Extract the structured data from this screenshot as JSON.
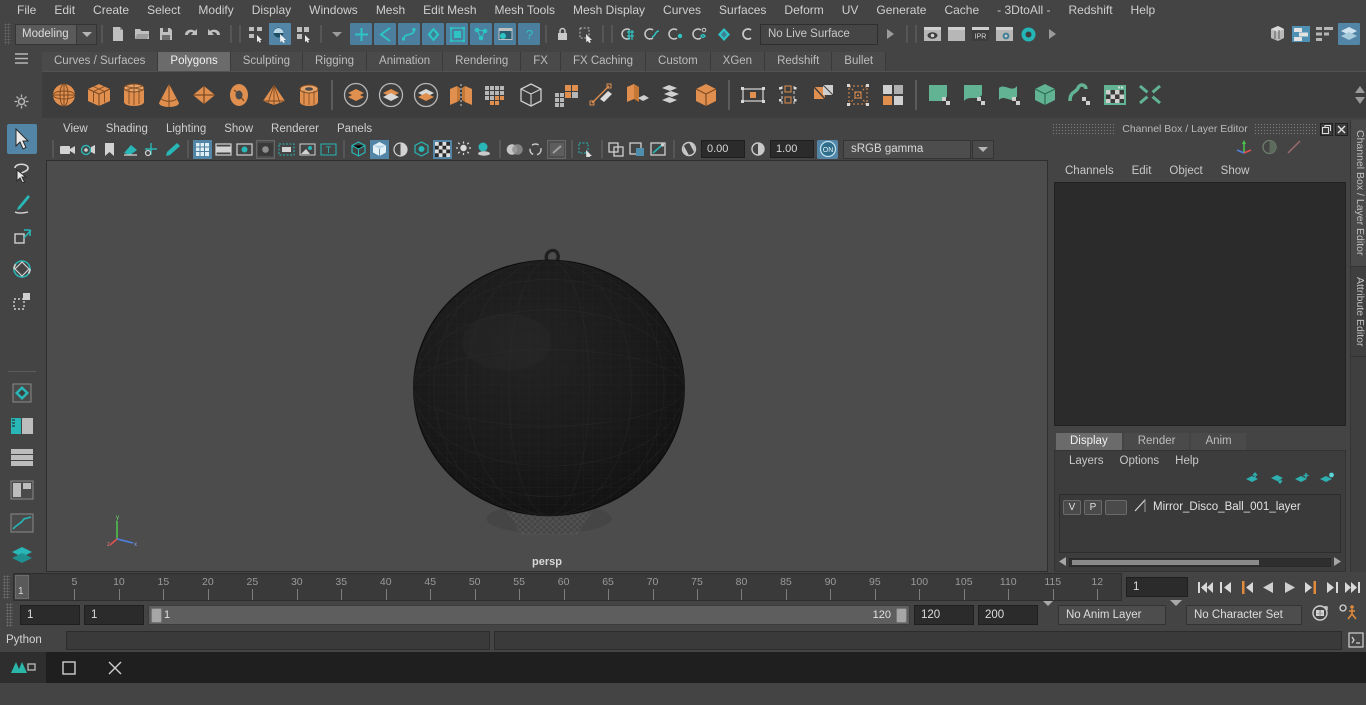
{
  "menubar": {
    "items": [
      "File",
      "Edit",
      "Create",
      "Select",
      "Modify",
      "Display",
      "Windows",
      "Mesh",
      "Edit Mesh",
      "Mesh Tools",
      "Mesh Display",
      "Curves",
      "Surfaces",
      "Deform",
      "UV",
      "Generate",
      "Cache",
      "- 3DtoAll -",
      "Redshift",
      "Help"
    ]
  },
  "statusline": {
    "menu_set": "Modeling",
    "live_surface": "No Live Surface",
    "icons": [
      {
        "name": "new-scene-icon"
      },
      {
        "name": "open-scene-icon"
      },
      {
        "name": "save-scene-icon"
      },
      {
        "name": "undo-icon"
      },
      {
        "name": "redo-icon"
      },
      {
        "name": "select-hierarchy-icon"
      },
      {
        "name": "select-object-icon"
      },
      {
        "name": "select-component-icon"
      },
      {
        "name": "snap-grid-icon"
      },
      {
        "name": "snap-curve-icon"
      },
      {
        "name": "snap-point-icon"
      },
      {
        "name": "snap-projected-center-icon"
      },
      {
        "name": "snap-view-plane-icon"
      },
      {
        "name": "make-live-icon"
      },
      {
        "name": "render-current-frame-icon"
      },
      {
        "name": "render-sequence-icon"
      },
      {
        "name": "ipr-render-icon"
      },
      {
        "name": "render-settings-icon"
      },
      {
        "name": "hypershade-icon"
      },
      {
        "name": "outliner-icon"
      },
      {
        "name": "node-editor-icon"
      },
      {
        "name": "attribute-editor-icon"
      },
      {
        "name": "channel-box-icon"
      }
    ]
  },
  "shelf": {
    "tabs": [
      "Curves / Surfaces",
      "Polygons",
      "Sculpting",
      "Rigging",
      "Animation",
      "Rendering",
      "FX",
      "FX Caching",
      "Custom",
      "XGen",
      "Redshift",
      "Bullet"
    ],
    "active_tab": "Polygons",
    "items": [
      {
        "name": "poly-sphere-icon",
        "color": "#e08f4e"
      },
      {
        "name": "poly-cube-icon",
        "color": "#e08f4e"
      },
      {
        "name": "poly-cylinder-icon",
        "color": "#e08f4e"
      },
      {
        "name": "poly-cone-icon",
        "color": "#e08f4e"
      },
      {
        "name": "poly-plane-icon",
        "color": "#e08f4e"
      },
      {
        "name": "poly-torus-icon",
        "color": "#e08f4e"
      },
      {
        "name": "poly-pyramid-icon",
        "color": "#e08f4e"
      },
      {
        "name": "poly-pipe-icon",
        "color": "#e08f4e"
      },
      {
        "name": "boolean-union-icon",
        "color": "#e08f4e"
      },
      {
        "name": "boolean-difference-icon",
        "color": "#e08f4e"
      },
      {
        "name": "boolean-intersection-icon",
        "color": "#e08f4e"
      },
      {
        "name": "mirror-geometry-icon",
        "color": "#e08f4e"
      },
      {
        "name": "smooth-mesh-icon",
        "color": "#b0b0b0"
      },
      {
        "name": "reduce-mesh-icon",
        "color": "#b0b0b0"
      },
      {
        "name": "quad-draw-icon",
        "color": "#e08f4e"
      },
      {
        "name": "multi-cut-icon",
        "color": "#e08f4e"
      },
      {
        "name": "extrude-icon",
        "color": "#e08f4e"
      },
      {
        "name": "bevel-icon",
        "color": "#b0b0b0"
      },
      {
        "name": "combine-icon",
        "color": "#e08f4e"
      },
      {
        "name": "uv-editor-icon",
        "color": "#d0d0d0"
      },
      {
        "name": "uv-planar-icon",
        "color": "#d0d0d0"
      },
      {
        "name": "uv-cut-icon",
        "color": "#e08f4e"
      },
      {
        "name": "uv-unfold-icon",
        "color": "#d0d0d0"
      },
      {
        "name": "uv-layout-icon",
        "color": "#d0d0d0"
      },
      {
        "name": "sculpt-plane-icon",
        "color": "#62b394"
      },
      {
        "name": "sculpt-curve-icon",
        "color": "#62b394"
      },
      {
        "name": "sculpt-surface-icon",
        "color": "#62b394"
      },
      {
        "name": "sculpt-cube-icon",
        "color": "#62b394"
      },
      {
        "name": "sculpt-wave-icon",
        "color": "#62b394"
      },
      {
        "name": "texture-window-icon",
        "color": "#62b394"
      },
      {
        "name": "transfer-attributes-icon",
        "color": "#62b394"
      }
    ]
  },
  "toolbox": {
    "items": [
      {
        "name": "select-tool"
      },
      {
        "name": "lasso-select-tool"
      },
      {
        "name": "paint-select-tool"
      },
      {
        "name": "move-tool"
      },
      {
        "name": "rotate-tool"
      },
      {
        "name": "scale-tool"
      },
      {
        "name": "last-tool-used"
      },
      {
        "name": "quick-layout-single"
      },
      {
        "name": "quick-layout-four"
      },
      {
        "name": "quick-layout-persp-outliner"
      },
      {
        "name": "quick-layout-persp-graph"
      },
      {
        "name": "quick-layout-hypershade"
      },
      {
        "name": "quick-layout-persp-uv"
      }
    ]
  },
  "viewport": {
    "menus": [
      "View",
      "Shading",
      "Lighting",
      "Show",
      "Renderer",
      "Panels"
    ],
    "camera_label": "persp",
    "exposure": "0.00",
    "gamma": "1.00",
    "color_management": "sRGB gamma",
    "toolbar_icons": [
      {
        "name": "select-camera-icon"
      },
      {
        "name": "camera-attributes-icon"
      },
      {
        "name": "bookmark-icon"
      },
      {
        "name": "image-plane-icon"
      },
      {
        "name": "two-d-pan-zoom-icon"
      },
      {
        "name": "grease-pencil-icon"
      },
      {
        "name": "grid-toggle-icon"
      },
      {
        "name": "film-gate-icon"
      },
      {
        "name": "resolution-gate-icon"
      },
      {
        "name": "gate-mask-icon"
      },
      {
        "name": "field-chart-icon"
      },
      {
        "name": "safe-action-icon"
      },
      {
        "name": "safe-title-icon"
      },
      {
        "name": "wireframe-shading-icon"
      },
      {
        "name": "smooth-shade-all-icon"
      },
      {
        "name": "shaded-wireframe-icon"
      },
      {
        "name": "use-default-material-icon"
      },
      {
        "name": "xray-display-icon"
      },
      {
        "name": "textured-mode-icon"
      },
      {
        "name": "use-all-lights-icon"
      },
      {
        "name": "shadows-icon"
      },
      {
        "name": "screen-space-ao-icon"
      },
      {
        "name": "motion-blur-icon"
      },
      {
        "name": "multisample-aa-icon"
      },
      {
        "name": "isolate-select-icon"
      },
      {
        "name": "xray-joints-icon"
      },
      {
        "name": "xray-active-components-icon"
      },
      {
        "name": "exposure-icon"
      },
      {
        "name": "gamma-icon"
      },
      {
        "name": "color-management-toggle-icon"
      }
    ]
  },
  "right_panel": {
    "title": "Channel Box / Layer Editor",
    "menus": [
      "Channels",
      "Edit",
      "Object",
      "Show"
    ],
    "vertical_tabs": [
      "Channel Box / Layer Editor",
      "Attribute Editor"
    ],
    "layer_tabs": [
      "Display",
      "Render",
      "Anim"
    ],
    "active_layer_tab": "Display",
    "layer_menus": [
      "Layers",
      "Options",
      "Help"
    ],
    "layers": [
      {
        "visibility": "V",
        "playback": "P",
        "color_swatch": "",
        "name": "Mirror_Disco_Ball_001_layer"
      }
    ]
  },
  "timeline": {
    "ticks": [
      5,
      10,
      15,
      20,
      25,
      30,
      35,
      40,
      45,
      50,
      55,
      60,
      65,
      70,
      75,
      80,
      85,
      90,
      95,
      100,
      105,
      110,
      115,
      "12"
    ],
    "current_frame_marker": "1",
    "current_frame_field": "1",
    "playback_buttons": [
      {
        "name": "go-to-start-button"
      },
      {
        "name": "step-back-frame-button"
      },
      {
        "name": "step-back-key-button"
      },
      {
        "name": "play-backwards-button"
      },
      {
        "name": "play-forwards-button"
      },
      {
        "name": "step-forward-key-button"
      },
      {
        "name": "step-forward-frame-button"
      },
      {
        "name": "go-to-end-button"
      }
    ]
  },
  "range_slider": {
    "anim_start": "1",
    "range_start": "1",
    "bar_start_label": "1",
    "bar_end_label": "120",
    "range_end": "120",
    "anim_end": "200",
    "anim_layer": "No Anim Layer",
    "character_set": "No Character Set",
    "icons": [
      {
        "name": "auto-keyframe-toggle-icon"
      },
      {
        "name": "animation-preferences-icon"
      }
    ]
  },
  "command_line": {
    "language": "Python",
    "input_value": "",
    "output_value": "",
    "script_editor_icon": "script-editor-icon"
  },
  "taskbar": {
    "items": [
      {
        "name": "taskbar-app-maya"
      },
      {
        "name": "taskbar-minimize"
      },
      {
        "name": "taskbar-close"
      }
    ]
  },
  "colors": {
    "accent_blue": "#5285a6",
    "shelf_orange": "#e08f4e",
    "shelf_green": "#62b394",
    "teal": "#29b6b6",
    "bg": "#444444",
    "viewport_bg": "#4c4c4c"
  }
}
